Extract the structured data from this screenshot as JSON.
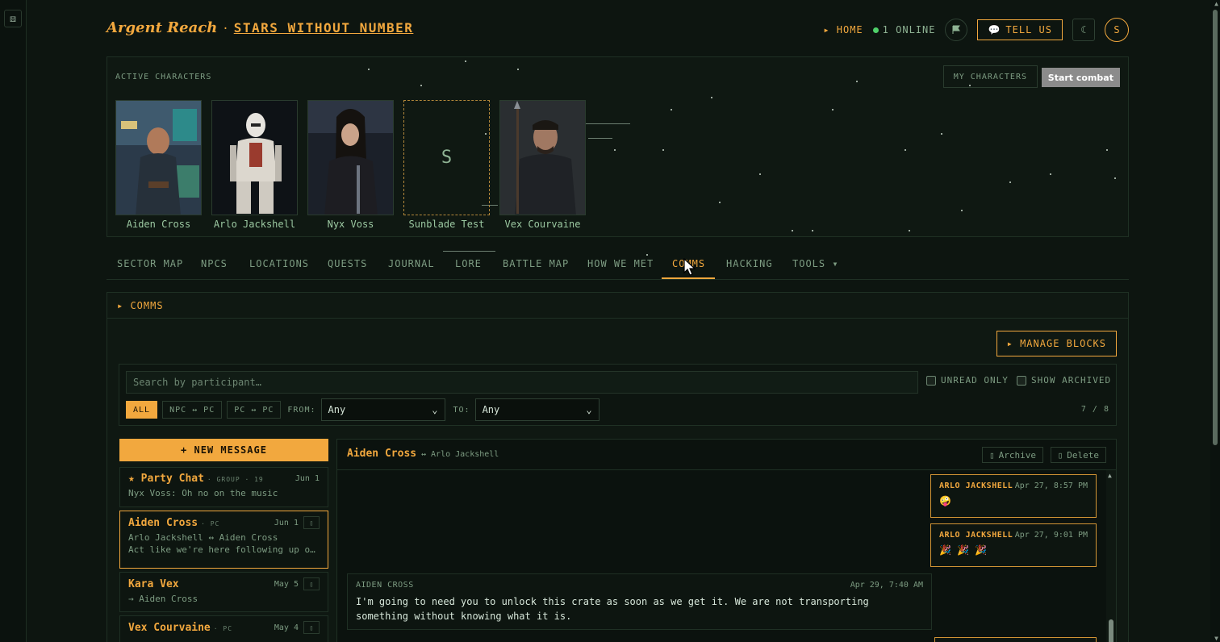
{
  "brand": {
    "name": "Argent Reach",
    "separator": "·",
    "game": "STARS WITHOUT NUMBER"
  },
  "header": {
    "home_label": "▸ HOME",
    "online_label": "1 ONLINE",
    "tell_us_label": "TELL US",
    "avatar_initial": "S"
  },
  "active": {
    "title": "ACTIVE CHARACTERS",
    "my_characters_label": "MY CHARACTERS",
    "start_combat_label": "Start combat",
    "characters": [
      {
        "name": "Aiden Cross"
      },
      {
        "name": "Arlo Jackshell"
      },
      {
        "name": "Nyx Voss"
      },
      {
        "name": "Sunblade Test",
        "initial": "S"
      },
      {
        "name": "Vex Courvaine"
      }
    ]
  },
  "nav": {
    "tabs": [
      "SECTOR MAP",
      "NPCS",
      "LOCATIONS",
      "QUESTS",
      "JOURNAL",
      "LORE",
      "BATTLE MAP",
      "HOW WE MET",
      "COMMS",
      "HACKING",
      "TOOLS ▾"
    ],
    "active": "COMMS"
  },
  "comms": {
    "title": "▸ COMMS",
    "manage_blocks_label": "▸ MANAGE BLOCKS",
    "search_placeholder": "Search by participant…",
    "unread_only_label": "UNREAD ONLY",
    "show_archived_label": "SHOW ARCHIVED",
    "chips": [
      "ALL",
      "NPC ↔ PC",
      "PC ↔ PC"
    ],
    "from_label": "FROM:",
    "from_value": "Any",
    "to_label": "TO:",
    "to_value": "Any",
    "count": "7 / 8",
    "new_message_label": "+ NEW MESSAGE",
    "threads": [
      {
        "name": "★ Party Chat",
        "tag": "· GROUP · 19",
        "date": "Jun 1",
        "line1": "Nyx Voss: Oh no on the music"
      },
      {
        "name": "Aiden Cross",
        "tag": "· PC",
        "date": "Jun 1",
        "line1": "Arlo Jackshell ↔ Aiden Cross",
        "line2": "Act like we're here following up on the request from the client"
      },
      {
        "name": "Kara Vex",
        "tag": "",
        "date": "May 5",
        "line1": "→ Aiden Cross"
      },
      {
        "name": "Vex Courvaine",
        "tag": "· PC",
        "date": "May 4"
      }
    ]
  },
  "conversation": {
    "name": "Aiden Cross",
    "with": "↔ Arlo Jackshell",
    "archive_label": "Archive",
    "delete_label": "Delete",
    "messages": [
      {
        "author": "ARLO JACKSHELL",
        "time": "Apr 27, 8:57 PM",
        "body": "🤪"
      },
      {
        "author": "ARLO JACKSHELL",
        "time": "Apr 27, 9:01 PM",
        "body": "🎉 🎉 🎉"
      },
      {
        "author": "AIDEN CROSS",
        "time": "Apr 29, 7:40 AM",
        "body": "I'm going to need you to unlock this crate as soon as we get it. We are not transporting something without knowing what it is."
      }
    ]
  },
  "colors": {
    "accent": "#f2a83e",
    "background": "#0d1510",
    "text": "#8fb394",
    "online": "#4fd06a"
  }
}
